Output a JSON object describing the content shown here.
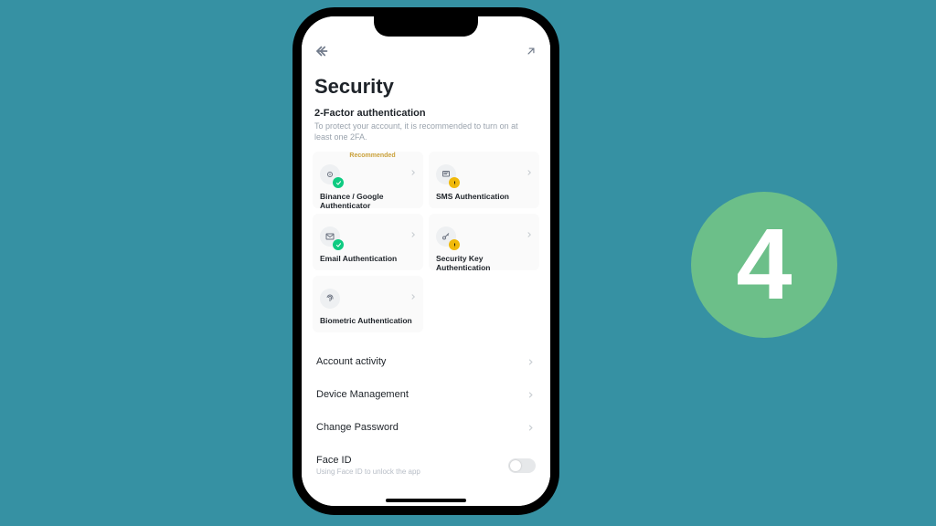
{
  "step_number": "4",
  "screen": {
    "title": "Security",
    "section": {
      "heading": "2-Factor authentication",
      "subheading": "To protect your account, it is recommended to turn on at least one 2FA."
    },
    "recommended_label": "Recommended",
    "tiles": [
      {
        "label": "Binance / Google Authenticator",
        "status": "ok",
        "icon": "shield-authenticator",
        "recommended": true
      },
      {
        "label": "SMS Authentication",
        "status": "warn",
        "icon": "sms",
        "recommended": false
      },
      {
        "label": "Email Authentication",
        "status": "ok",
        "icon": "mail",
        "recommended": false
      },
      {
        "label": "Security Key Authentication",
        "status": "warn",
        "icon": "key",
        "recommended": false
      },
      {
        "label": "Biometric Authentication",
        "status": "none",
        "icon": "fingerprint",
        "recommended": false
      }
    ],
    "rows": [
      {
        "label": "Account activity",
        "type": "nav"
      },
      {
        "label": "Device Management",
        "type": "nav"
      },
      {
        "label": "Change Password",
        "type": "nav"
      },
      {
        "label": "Face ID",
        "sub": "Using Face ID to unlock the app",
        "type": "toggle",
        "toggle_on": false
      }
    ]
  }
}
